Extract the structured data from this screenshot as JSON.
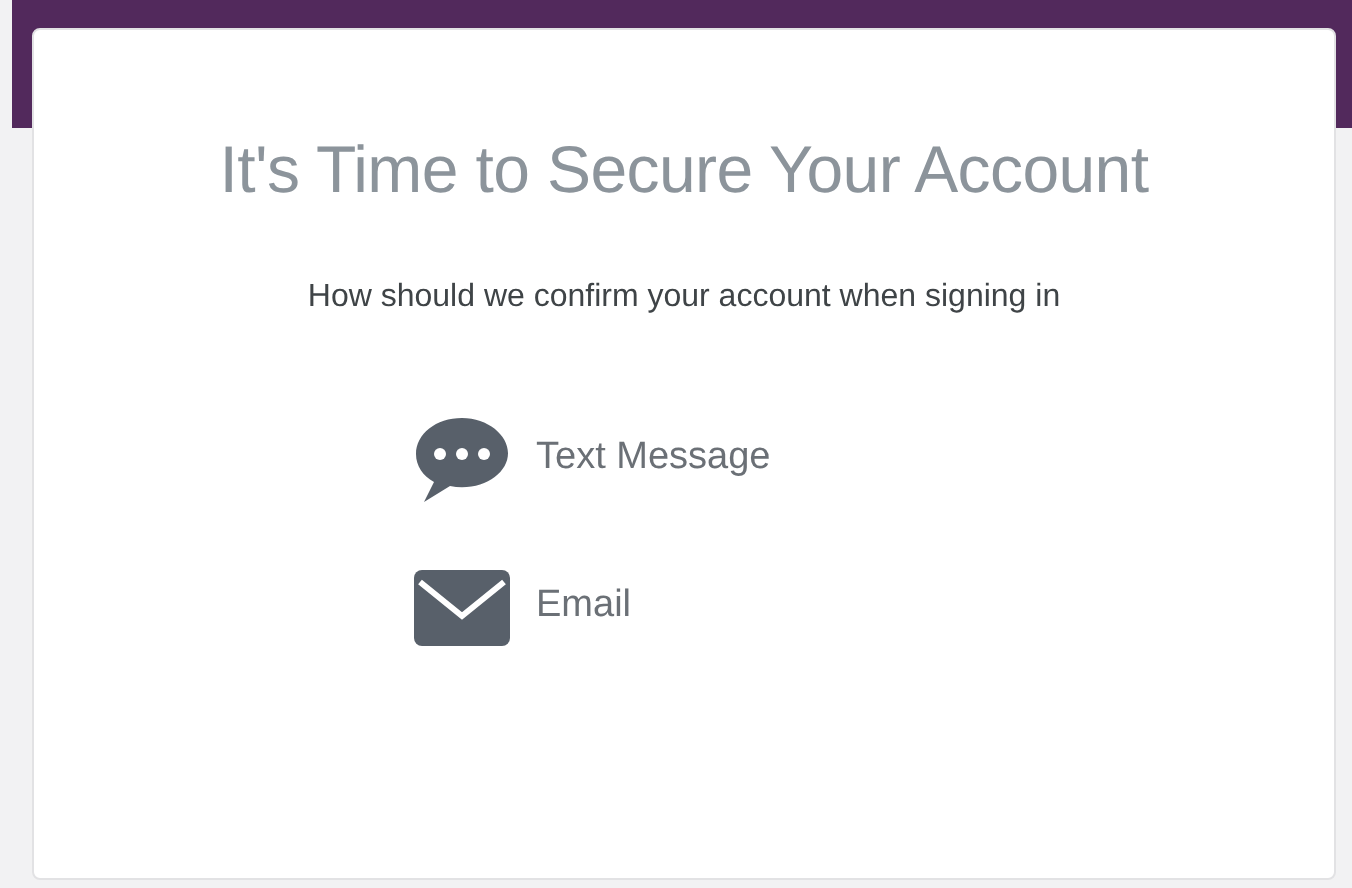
{
  "card": {
    "title": "It's Time to Secure Your Account",
    "subtitle": "How should we confirm your account when signing in",
    "options": [
      {
        "kind": "sms",
        "label": "Text Message"
      },
      {
        "kind": "email",
        "label": "Email"
      }
    ]
  }
}
